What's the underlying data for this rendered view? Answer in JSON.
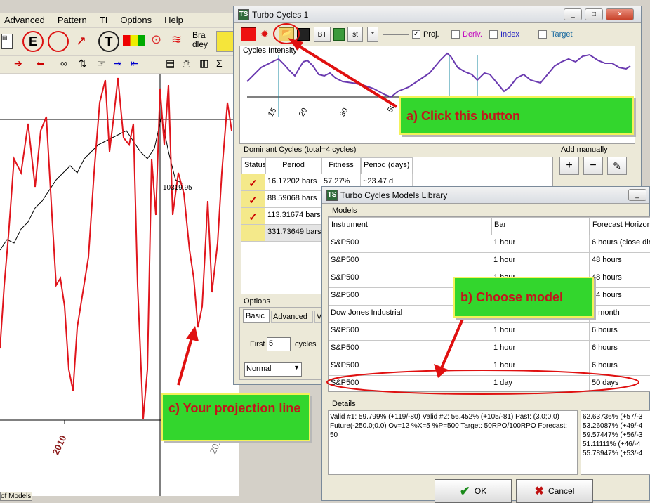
{
  "main_app": {
    "menu": [
      "Advanced",
      "Pattern",
      "TI",
      "Options",
      "Help"
    ],
    "toolbar_labels": {
      "bradley": "Bra dley"
    },
    "chart": {
      "price_label": "10319.95",
      "x_label_2010": "2010",
      "x_label_2011": "201",
      "bottom_tab": "of Models"
    }
  },
  "turbo_cycles": {
    "title": "Turbo Cycles 1",
    "toolbar": {
      "bt": "BT",
      "st": "st",
      "star": "*",
      "proj_label": "Proj.",
      "deriv_label": "Deriv.",
      "index_label": "Index",
      "target_label": "Target"
    },
    "intensity_label": "Cycles Intensity",
    "axis_ticks": [
      "15",
      "20",
      "30",
      "50"
    ],
    "dominant_header": "Dominant Cycles (total=4 cycles)",
    "columns": [
      "Status",
      "Period",
      "Fitness",
      "Period (days)"
    ],
    "rows": [
      {
        "period": "16.17202 bars",
        "fitness": "57.27%",
        "days": "~23.47 d",
        "checked": true
      },
      {
        "period": "88.59068 bars",
        "fitness": "",
        "days": "",
        "checked": true
      },
      {
        "period": "113.31674 bars",
        "fitness": "",
        "days": "",
        "checked": true
      },
      {
        "period": "331.73649 bars",
        "fitness": "",
        "days": "",
        "checked": false
      }
    ],
    "add_manually": "Add manually",
    "options": {
      "label": "Options",
      "tabs": [
        "Basic",
        "Advanced",
        "V"
      ],
      "first_label": "First",
      "first_value": "5",
      "cycles_label": "cycles",
      "mode_value": "Normal"
    }
  },
  "models_library": {
    "title": "Turbo Cycles Models Library",
    "models_label": "Models",
    "columns": [
      "Instrument",
      "Bar",
      "Forecast Horizon"
    ],
    "rows": [
      {
        "instrument": "S&P500",
        "bar": "1 hour",
        "horizon": "6 hours (close dire"
      },
      {
        "instrument": "S&P500",
        "bar": "1 hour",
        "horizon": "48 hours"
      },
      {
        "instrument": "S&P500",
        "bar": "1 hour",
        "horizon": "48 hours"
      },
      {
        "instrument": "S&P500",
        "bar": "1 hour",
        "horizon": "24 hours"
      },
      {
        "instrument": "Dow Jones Industrial",
        "bar": "",
        "horizon": "1 month"
      },
      {
        "instrument": "S&P500",
        "bar": "1 hour",
        "horizon": "6 hours"
      },
      {
        "instrument": "S&P500",
        "bar": "1 hour",
        "horizon": "6 hours"
      },
      {
        "instrument": "S&P500",
        "bar": "1 hour",
        "horizon": "6 hours"
      },
      {
        "instrument": "S&P500",
        "bar": "1 day",
        "horizon": "50 days"
      }
    ],
    "details_label": "Details",
    "details_text": "Valid #1: 59.799%  (+119/-80)   Valid #2: 56.452% (+105/-81)  Past: (3.0;0.0) Future(-250.0;0.0) Ov=12 %X=5 %P=500 Target: 50RPO/100RPO   Forecast: 50",
    "side_values": [
      "62.63736% (+57/-3",
      "53.26087% (+49/-4",
      "59.57447% (+56/-3",
      "51.11111% (+46/-4",
      "55.78947% (+53/-4"
    ],
    "ok_label": "OK",
    "cancel_label": "Cancel"
  },
  "callouts": {
    "a": "a) Click this button",
    "b": "b) Choose model",
    "c": "c) Your projection line"
  },
  "colors": {
    "accent_red": "#c3151c",
    "callout_green": "#33d62d",
    "projection": "#e0151c"
  }
}
